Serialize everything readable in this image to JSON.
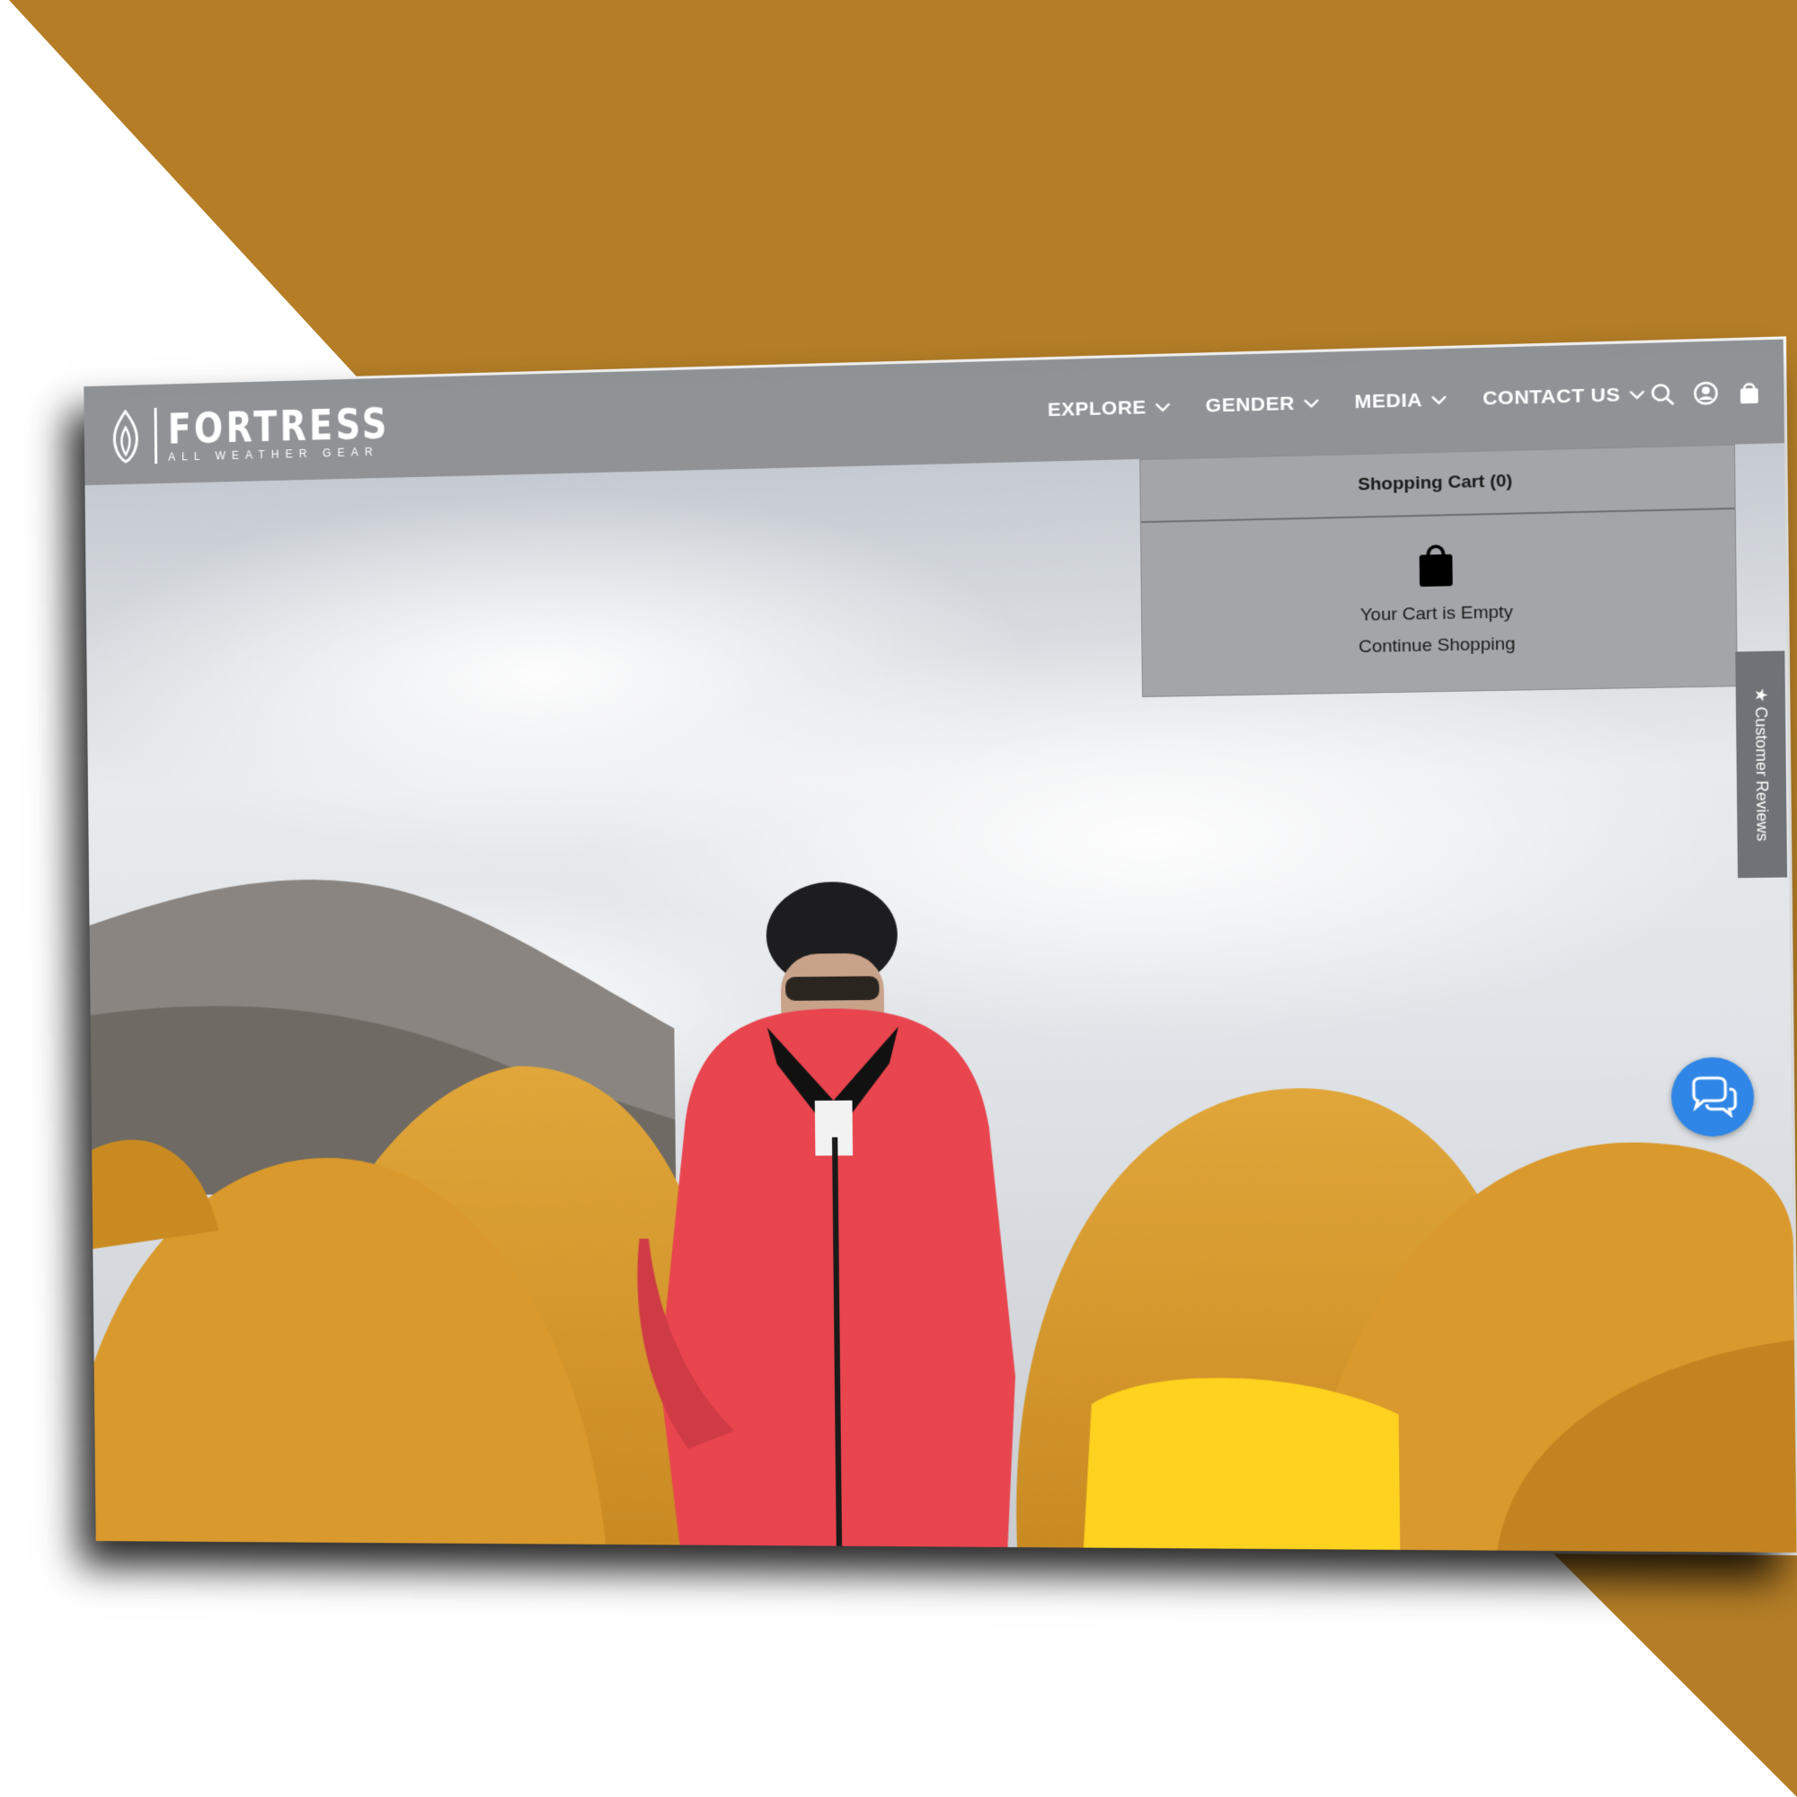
{
  "colors": {
    "background_accent": "#b57e26",
    "navbar": "#8e9093",
    "cart_panel": "#a3a5a8",
    "chat_button": "#2f86e6",
    "jacket": "#e8454f"
  },
  "brand": {
    "name": "FORTRESS",
    "tagline": "ALL WEATHER GEAR"
  },
  "nav": {
    "items": [
      {
        "label": "EXPLORE"
      },
      {
        "label": "GENDER"
      },
      {
        "label": "MEDIA"
      },
      {
        "label": "CONTACT US"
      }
    ],
    "icons": [
      "search-icon",
      "account-icon",
      "cart-icon"
    ]
  },
  "cart": {
    "title": "Shopping Cart (0)",
    "empty_message": "Your Cart is Empty",
    "continue_label": "Continue Shopping"
  },
  "reviews_tab": {
    "label": "★ Customer Reviews"
  },
  "chat": {
    "icon": "chat-icon"
  }
}
